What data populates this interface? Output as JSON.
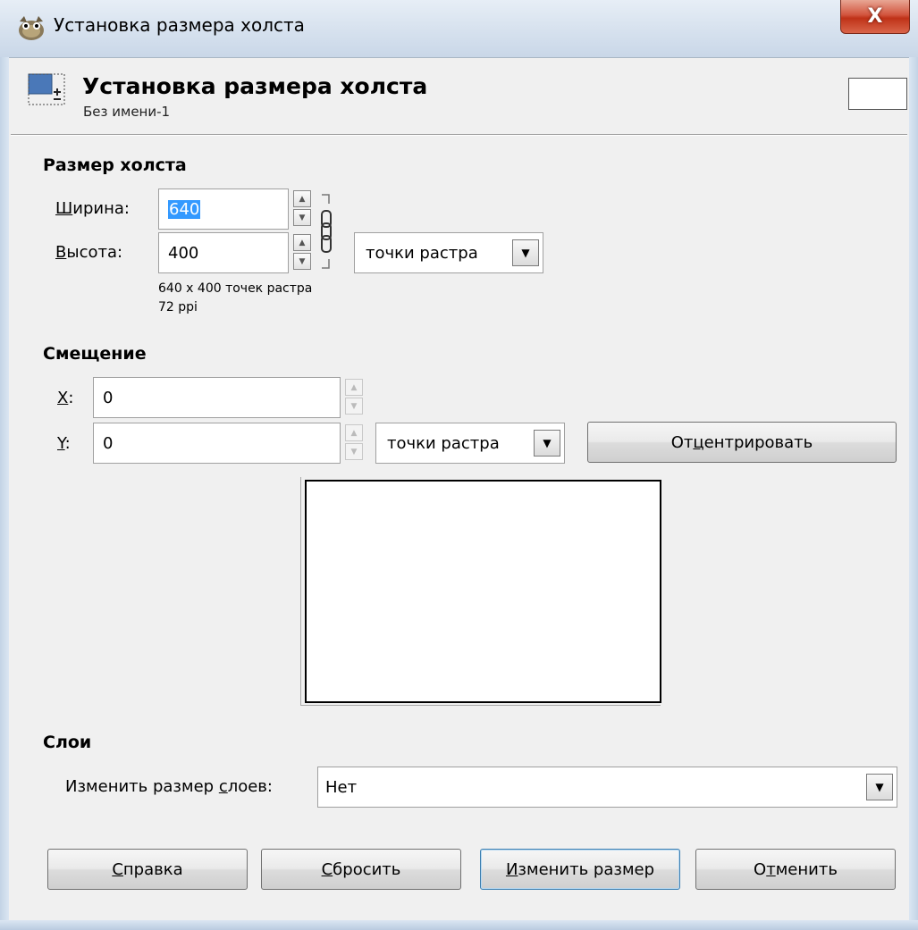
{
  "window": {
    "title": "Установка размера холста",
    "close_label": "X"
  },
  "header": {
    "title": "Установка размера холста",
    "subtitle": "Без имени-1"
  },
  "canvas_size": {
    "section_title": "Размер холста",
    "width_label_mnemonic": "Ш",
    "width_label_rest": "ирина:",
    "width_value": "640",
    "height_label_mnemonic": "В",
    "height_label_rest": "ысота:",
    "height_value": "400",
    "unit": "точки растра",
    "info_size": "640 x 400 точек растра",
    "info_resolution": "72 ppi"
  },
  "offset": {
    "section_title": "Смещение",
    "x_label_mnemonic": "X",
    "x_label_rest": ":",
    "x_value": "0",
    "y_label_mnemonic": "Y",
    "y_label_rest": ":",
    "y_value": "0",
    "unit": "точки растра",
    "center_pre": "От",
    "center_mnemonic": "ц",
    "center_post": "ентрировать"
  },
  "layers": {
    "section_title": "Слои",
    "resize_label_pre": "Изменить размер ",
    "resize_label_mnemonic": "с",
    "resize_label_post": "лоев:",
    "resize_value": "Нет"
  },
  "buttons": {
    "help_mnemonic": "С",
    "help_rest": "правка",
    "reset_mnemonic": "С",
    "reset_rest": "бросить",
    "resize_mnemonic": "И",
    "resize_rest": "зменить размер",
    "cancel_pre": "О",
    "cancel_mnemonic": "т",
    "cancel_post": "менить"
  },
  "icons": {
    "app": "gimp-icon",
    "header": "canvas-size-icon",
    "chain": "chain-link-icon",
    "dropdown": "chevron-down-icon"
  }
}
